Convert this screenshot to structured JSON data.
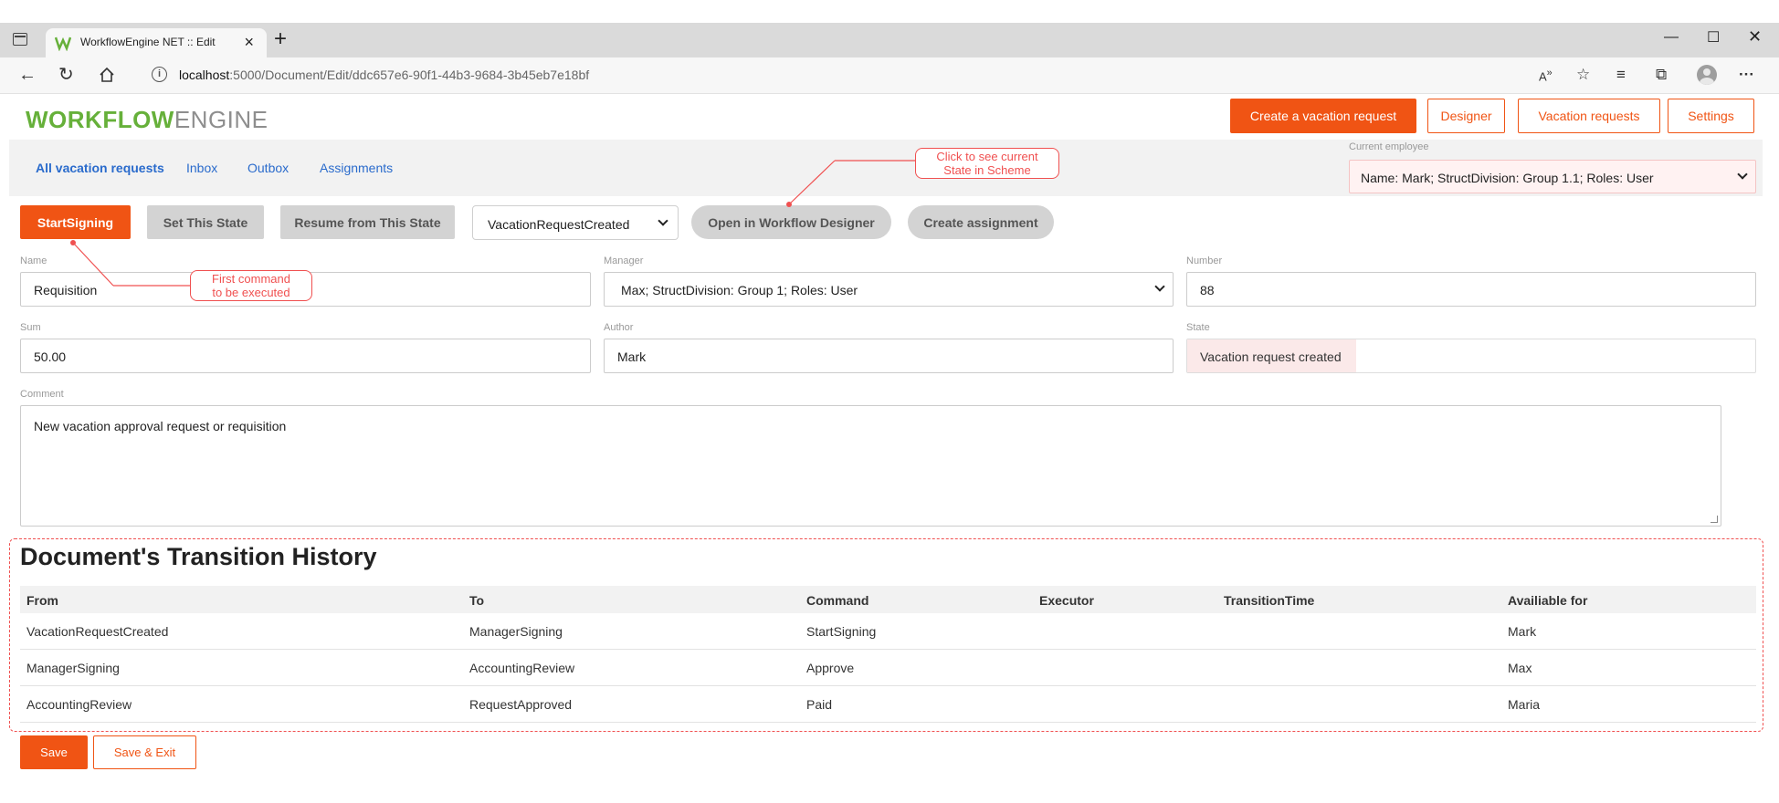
{
  "browser": {
    "tab_title": "WorkflowEngine NET :: Edit",
    "url_host": "localhost",
    "url_rest": ":5000/Document/Edit/ddc657e6-90f1-44b3-9684-3b45eb7e18bf"
  },
  "brand": {
    "part1": "WORKFLOW",
    "part2": "ENGINE"
  },
  "header_buttons": {
    "create": "Create a vacation request",
    "designer": "Designer",
    "vacation_requests": "Vacation requests",
    "settings": "Settings"
  },
  "subnav": {
    "all": "All vacation requests",
    "inbox": "Inbox",
    "outbox": "Outbox",
    "assignments": "Assignments"
  },
  "current_employee": {
    "label": "Current employee",
    "value": "Name: Mark; StructDivision: Group 1.1; Roles: User"
  },
  "commands": {
    "start_signing": "StartSigning",
    "set_state": "Set This State",
    "resume": "Resume from This State",
    "state_select": "VacationRequestCreated",
    "open_designer": "Open in Workflow Designer",
    "create_assignment": "Create assignment"
  },
  "callouts": {
    "first_command": [
      "First command",
      "to be executed"
    ],
    "current_state": [
      "Click to see current",
      "State in Scheme"
    ]
  },
  "form": {
    "name_label": "Name",
    "name_value": "Requisition",
    "manager_label": "Manager",
    "manager_value": "Max; StructDivision: Group 1; Roles: User",
    "number_label": "Number",
    "number_value": "88",
    "sum_label": "Sum",
    "sum_value": "50.00",
    "author_label": "Author",
    "author_value": "Mark",
    "state_label": "State",
    "state_value": "Vacation request created",
    "comment_label": "Comment",
    "comment_value": "New vacation approval request or requisition"
  },
  "history": {
    "title": "Document's Transition History",
    "columns": [
      "From",
      "To",
      "Command",
      "Executor",
      "TransitionTime",
      "Availiable for"
    ],
    "rows": [
      [
        "VacationRequestCreated",
        "ManagerSigning",
        "StartSigning",
        "",
        "",
        "Mark"
      ],
      [
        "ManagerSigning",
        "AccountingReview",
        "Approve",
        "",
        "",
        "Max"
      ],
      [
        "AccountingReview",
        "RequestApproved",
        "Paid",
        "",
        "",
        "Maria"
      ]
    ]
  },
  "footer_buttons": {
    "save": "Save",
    "save_exit": "Save & Exit"
  },
  "colors": {
    "accent": "#f05414",
    "brand_green": "#66b03a",
    "link": "#2a6bcc",
    "callout": "#f05050"
  }
}
